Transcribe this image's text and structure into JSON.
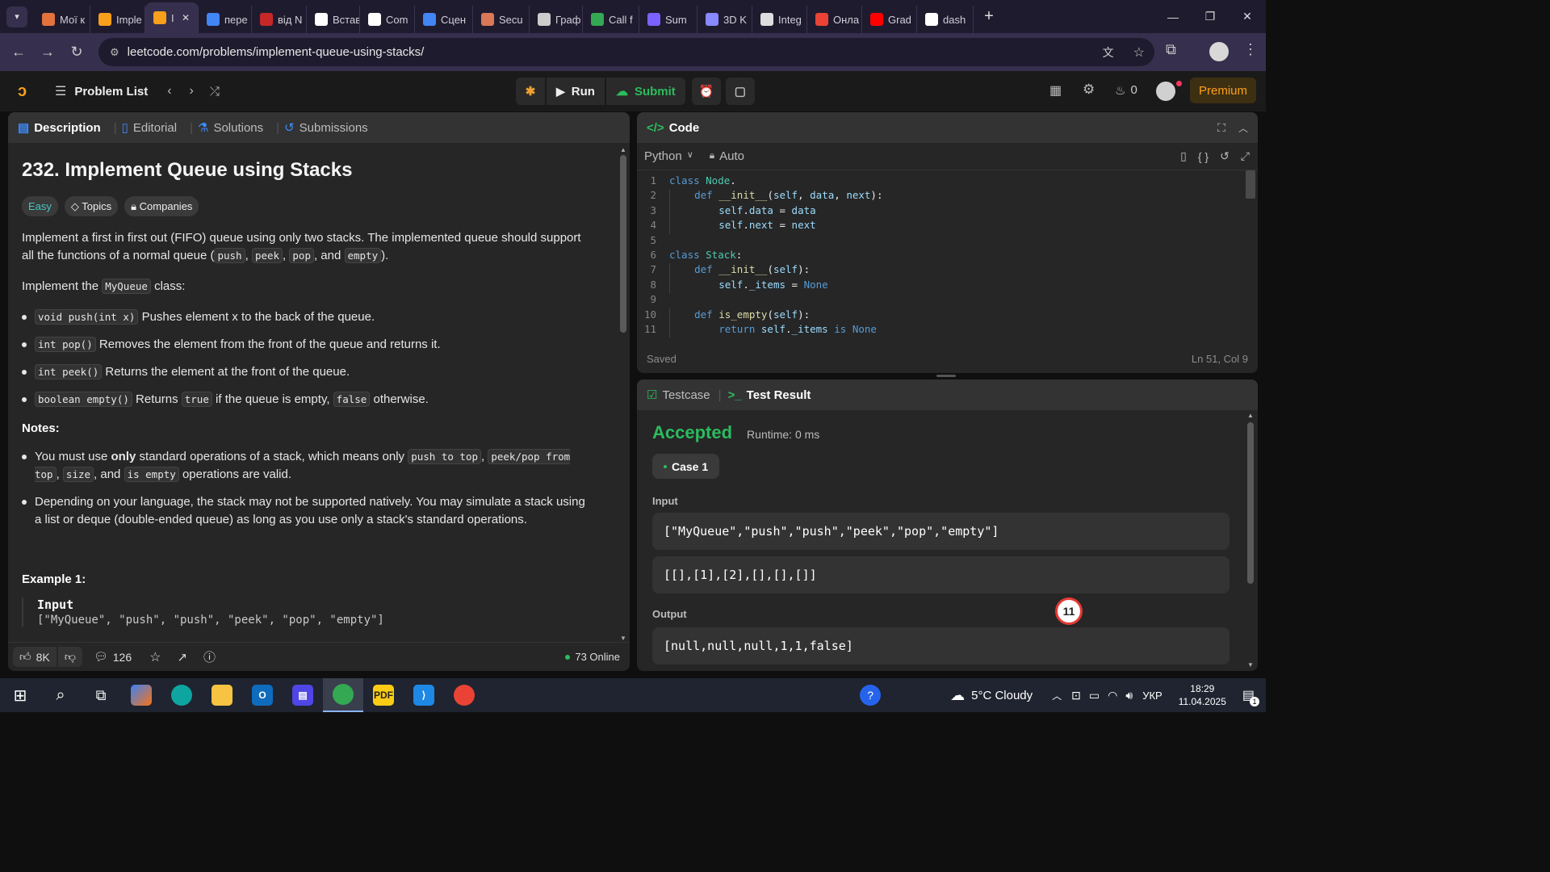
{
  "browser": {
    "tabs": [
      {
        "label": "Мої к",
        "icon": "m-logo-icon",
        "color": "#e4723c"
      },
      {
        "label": "Imple",
        "icon": "leetcode-logo-icon",
        "color": "#f89f1b"
      },
      {
        "label": "I",
        "icon": "leetcode-logo-icon",
        "color": "#f89f1b",
        "active": true
      },
      {
        "label": "пере",
        "icon": "google-logo-icon",
        "color": "#4285f4"
      },
      {
        "label": "від N",
        "icon": "wp-logo-icon",
        "color": "#c62828"
      },
      {
        "label": "Встав",
        "icon": "openai-logo-icon",
        "color": "#ffffff"
      },
      {
        "label": "Com",
        "icon": "github-logo-icon",
        "color": "#ffffff"
      },
      {
        "label": "Сцен",
        "icon": "docs-icon",
        "color": "#4285f4"
      },
      {
        "label": "Secu",
        "icon": "claude-logo-icon",
        "color": "#d97757"
      },
      {
        "label": "Граф",
        "icon": "chart-line-icon",
        "color": "#cccccc"
      },
      {
        "label": "Call f",
        "icon": "drive-icon",
        "color": "#34a853"
      },
      {
        "label": "Sum",
        "icon": "list-app-icon",
        "color": "#7b61ff"
      },
      {
        "label": "3D K",
        "icon": "triangle-logo-icon",
        "color": "#8888ff"
      },
      {
        "label": "Integ",
        "icon": "integral-logo-icon",
        "color": "#dddddd"
      },
      {
        "label": "Онла",
        "icon": "gmail-icon",
        "color": "#ea4335"
      },
      {
        "label": "Grad",
        "icon": "youtube-icon",
        "color": "#ff0000"
      },
      {
        "label": "dash",
        "icon": "github-logo-icon",
        "color": "#ffffff"
      }
    ],
    "new_tab": "+",
    "url": "leetcode.com/problems/implement-queue-using-stacks/"
  },
  "header": {
    "problem_list": "Problem List",
    "run": "Run",
    "submit": "Submit",
    "streak": "0",
    "premium": "Premium"
  },
  "description": {
    "tabs": [
      "Description",
      "Editorial",
      "Solutions",
      "Submissions"
    ],
    "title": "232. Implement Queue using Stacks",
    "difficulty": "Easy",
    "topics": "Topics",
    "companies": "Companies",
    "intro_1": "Implement a first in first out (FIFO) queue using only two stacks. The implemented queue should support all the functions of a normal queue (",
    "intro_push": "push",
    "intro_peek": "peek",
    "intro_pop": "pop",
    "intro_and": ", and ",
    "intro_empty": "empty",
    "intro_end": ").",
    "implement_a": "Implement the ",
    "implement_code": "MyQueue",
    "implement_b": " class:",
    "methods": [
      {
        "code": "void push(int x)",
        "text": " Pushes element x to the back of the queue."
      },
      {
        "code": "int pop()",
        "text": " Removes the element from the front of the queue and returns it."
      },
      {
        "code": "int peek()",
        "text": " Returns the element at the front of the queue."
      },
      {
        "code": "boolean empty()",
        "text": " Returns ",
        "code2": "true",
        "text2": " if the queue is empty, ",
        "code3": "false",
        "text3": " otherwise."
      }
    ],
    "notes_title": "Notes:",
    "note1_a": "You must use ",
    "note1_b": "only",
    "note1_c": " standard operations of a stack, which means only ",
    "note1_code1": "push to top",
    "note1_code2": "peek/pop from top",
    "note1_code3": "size",
    "note1_and": ", and ",
    "note1_code4": "is empty",
    "note1_end": " operations are valid.",
    "note2": "Depending on your language, the stack may not be supported natively. You may simulate a stack using a list or deque (double-ended queue) as long as you use only a stack's standard operations.",
    "example_title": "Example 1:",
    "example_input_label": "Input",
    "example_input": "[\"MyQueue\", \"push\", \"push\", \"peek\", \"pop\", \"empty\"]",
    "likes": "8K",
    "comments": "126",
    "online": "73 Online"
  },
  "editor": {
    "title": "Code",
    "language": "Python",
    "mode": "Auto",
    "status": "Saved",
    "cursor": "Ln 51, Col 9",
    "lines": [
      {
        "n": "1",
        "indent": "",
        "parts": [
          [
            "kw",
            "class "
          ],
          [
            "cls",
            "Node"
          ],
          [
            "",
            "."
          ]
        ]
      },
      {
        "n": "2",
        "indent": "    ",
        "parts": [
          [
            "kw",
            "def "
          ],
          [
            "fn",
            "__init__"
          ],
          [
            "",
            "("
          ],
          [
            "var",
            "self"
          ],
          [
            "",
            ", "
          ],
          [
            "var",
            "data"
          ],
          [
            "",
            ", "
          ],
          [
            "var",
            "next"
          ],
          [
            "",
            "):"
          ]
        ]
      },
      {
        "n": "3",
        "indent": "        ",
        "parts": [
          [
            "var",
            "self"
          ],
          [
            "",
            "."
          ],
          [
            "var",
            "data"
          ],
          [
            "",
            " = "
          ],
          [
            "var",
            "data"
          ]
        ]
      },
      {
        "n": "4",
        "indent": "        ",
        "parts": [
          [
            "var",
            "self"
          ],
          [
            "",
            "."
          ],
          [
            "var",
            "next"
          ],
          [
            "",
            " = "
          ],
          [
            "var",
            "next"
          ]
        ]
      },
      {
        "n": "5",
        "indent": "",
        "parts": []
      },
      {
        "n": "6",
        "indent": "",
        "parts": [
          [
            "kw",
            "class "
          ],
          [
            "cls",
            "Stack"
          ],
          [
            "",
            ":"
          ]
        ]
      },
      {
        "n": "7",
        "indent": "    ",
        "parts": [
          [
            "kw",
            "def "
          ],
          [
            "fn",
            "__init__"
          ],
          [
            "",
            "("
          ],
          [
            "var",
            "self"
          ],
          [
            "",
            "):"
          ]
        ]
      },
      {
        "n": "8",
        "indent": "        ",
        "parts": [
          [
            "var",
            "self"
          ],
          [
            "",
            "."
          ],
          [
            "var",
            "_items"
          ],
          [
            "",
            " = "
          ],
          [
            "kw",
            "None"
          ]
        ]
      },
      {
        "n": "9",
        "indent": "",
        "parts": []
      },
      {
        "n": "10",
        "indent": "    ",
        "parts": [
          [
            "kw",
            "def "
          ],
          [
            "fn",
            "is_empty"
          ],
          [
            "",
            "("
          ],
          [
            "var",
            "self"
          ],
          [
            "",
            "):"
          ]
        ]
      },
      {
        "n": "11",
        "indent": "        ",
        "parts": [
          [
            "kw",
            "return "
          ],
          [
            "var",
            "self"
          ],
          [
            "",
            "."
          ],
          [
            "var",
            "_items"
          ],
          [
            "kw",
            " is "
          ],
          [
            "kw",
            "None"
          ]
        ]
      }
    ]
  },
  "result": {
    "tab_testcase": "Testcase",
    "tab_result": "Test Result",
    "status": "Accepted",
    "runtime": "Runtime: 0 ms",
    "case": "Case 1",
    "input_label": "Input",
    "input_1": "[\"MyQueue\",\"push\",\"push\",\"peek\",\"pop\",\"empty\"]",
    "input_2": "[[],[1],[2],[],[],[]]",
    "output_label": "Output",
    "output": "[null,null,null,1,1,false]",
    "badge": "11"
  },
  "taskbar": {
    "weather": "5°C  Cloudy",
    "lang": "УКР",
    "time": "18:29",
    "date": "11.04.2025",
    "notifications": "1"
  },
  "colors": {
    "accent_green": "#2cbb5d",
    "premium": "#ffa116",
    "active_tab": "#362f4d"
  }
}
